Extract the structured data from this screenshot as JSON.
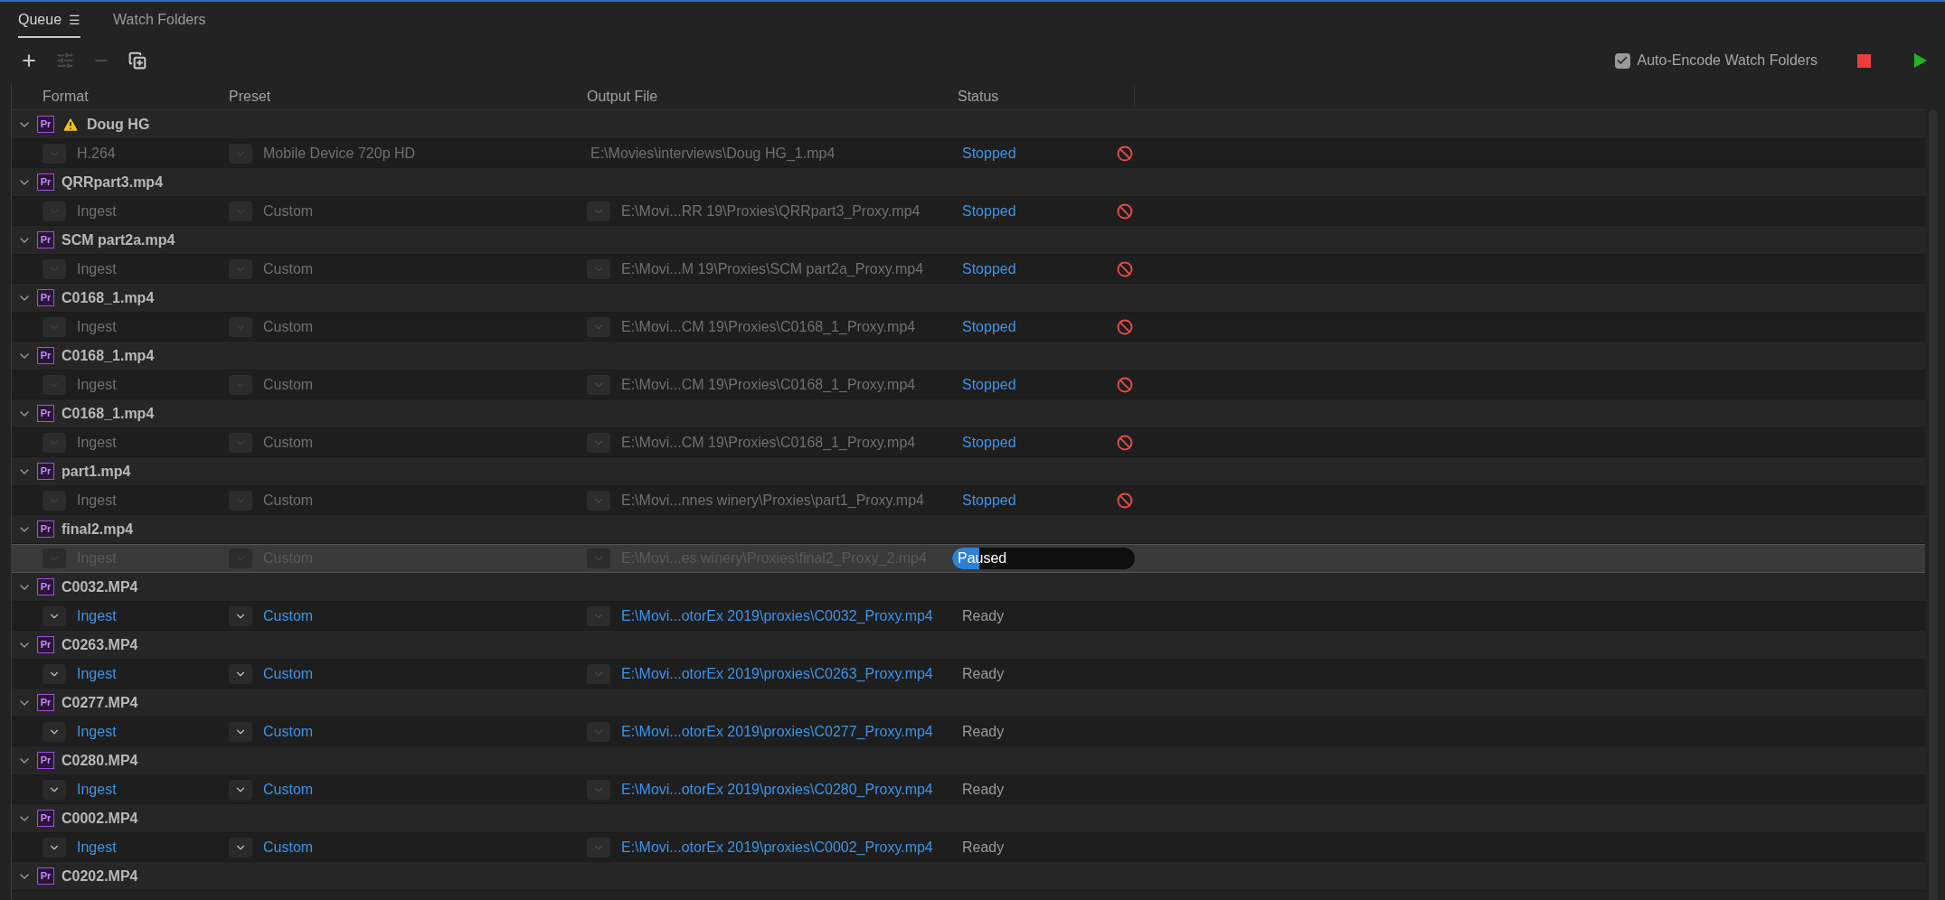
{
  "tabs": [
    {
      "label": "Queue",
      "selected": true,
      "menu": "☰"
    },
    {
      "label": "Watch Folders",
      "selected": false
    }
  ],
  "toolbar": [
    {
      "kind": "add",
      "disabled": false
    },
    {
      "kind": "settings",
      "disabled": true
    },
    {
      "kind": "remove",
      "disabled": true
    },
    {
      "kind": "duplicate",
      "disabled": false
    }
  ],
  "auto_encode": {
    "label": "Auto-Encode Watch Folders",
    "checked": true
  },
  "columns": [
    "Format",
    "Preset",
    "Output File",
    "Status"
  ],
  "groups": [
    {
      "name": "Doug HG",
      "badge": "Pr",
      "warning": true,
      "expanded": true,
      "items": [
        {
          "format": "H.264",
          "preset": "Mobile Device 720p HD",
          "output": "E:\\Movies\\interviews\\Doug HG_1.mp4",
          "output_menu": false,
          "enabled": false,
          "selected": false,
          "status": {
            "kind": "stopped",
            "text": "Stopped"
          }
        }
      ]
    },
    {
      "name": "QRRpart3.mp4",
      "badge": "Pr",
      "warning": false,
      "expanded": true,
      "items": [
        {
          "format": "Ingest",
          "preset": "Custom",
          "output": "E:\\Movi...RR 19\\Proxies\\QRRpart3_Proxy.mp4",
          "output_menu": true,
          "enabled": false,
          "selected": false,
          "status": {
            "kind": "stopped",
            "text": "Stopped"
          }
        }
      ]
    },
    {
      "name": "SCM part2a.mp4",
      "badge": "Pr",
      "warning": false,
      "expanded": true,
      "items": [
        {
          "format": "Ingest",
          "preset": "Custom",
          "output": "E:\\Movi...M 19\\Proxies\\SCM part2a_Proxy.mp4",
          "output_menu": true,
          "enabled": false,
          "selected": false,
          "status": {
            "kind": "stopped",
            "text": "Stopped"
          }
        }
      ]
    },
    {
      "name": "C0168_1.mp4",
      "badge": "Pr",
      "warning": false,
      "expanded": true,
      "items": [
        {
          "format": "Ingest",
          "preset": "Custom",
          "output": "E:\\Movi...CM 19\\Proxies\\C0168_1_Proxy.mp4",
          "output_menu": true,
          "enabled": false,
          "selected": false,
          "status": {
            "kind": "stopped",
            "text": "Stopped"
          }
        }
      ]
    },
    {
      "name": "C0168_1.mp4",
      "badge": "Pr",
      "warning": false,
      "expanded": true,
      "items": [
        {
          "format": "Ingest",
          "preset": "Custom",
          "output": "E:\\Movi...CM 19\\Proxies\\C0168_1_Proxy.mp4",
          "output_menu": true,
          "enabled": false,
          "selected": false,
          "status": {
            "kind": "stopped",
            "text": "Stopped"
          }
        }
      ]
    },
    {
      "name": "C0168_1.mp4",
      "badge": "Pr",
      "warning": false,
      "expanded": true,
      "items": [
        {
          "format": "Ingest",
          "preset": "Custom",
          "output": "E:\\Movi...CM 19\\Proxies\\C0168_1_Proxy.mp4",
          "output_menu": true,
          "enabled": false,
          "selected": false,
          "status": {
            "kind": "stopped",
            "text": "Stopped"
          }
        }
      ]
    },
    {
      "name": "part1.mp4",
      "badge": "Pr",
      "warning": false,
      "expanded": true,
      "items": [
        {
          "format": "Ingest",
          "preset": "Custom",
          "output": "E:\\Movi...nnes winery\\Proxies\\part1_Proxy.mp4",
          "output_menu": true,
          "enabled": false,
          "selected": false,
          "status": {
            "kind": "stopped",
            "text": "Stopped"
          }
        }
      ]
    },
    {
      "name": "final2.mp4",
      "badge": "Pr",
      "warning": false,
      "expanded": true,
      "items": [
        {
          "format": "Ingest",
          "preset": "Custom",
          "output": "E:\\Movi...es winery\\Proxies\\final2_Proxy_2.mp4",
          "output_menu": true,
          "enabled": false,
          "selected": true,
          "status": {
            "kind": "paused",
            "text": "Paused",
            "level": 0.15
          }
        }
      ]
    },
    {
      "name": "C0032.MP4",
      "badge": "Pr",
      "warning": false,
      "expanded": true,
      "items": [
        {
          "format": "Ingest",
          "preset": "Custom",
          "output": "E:\\Movi...otorEx 2019\\proxies\\C0032_Proxy.mp4",
          "output_menu": true,
          "enabled": true,
          "selected": false,
          "status": {
            "kind": "ready",
            "text": "Ready"
          }
        }
      ]
    },
    {
      "name": "C0263.MP4",
      "badge": "Pr",
      "warning": false,
      "expanded": true,
      "items": [
        {
          "format": "Ingest",
          "preset": "Custom",
          "output": "E:\\Movi...otorEx 2019\\proxies\\C0263_Proxy.mp4",
          "output_menu": true,
          "enabled": true,
          "selected": false,
          "status": {
            "kind": "ready",
            "text": "Ready"
          }
        }
      ]
    },
    {
      "name": "C0277.MP4",
      "badge": "Pr",
      "warning": false,
      "expanded": true,
      "items": [
        {
          "format": "Ingest",
          "preset": "Custom",
          "output": "E:\\Movi...otorEx 2019\\proxies\\C0277_Proxy.mp4",
          "output_menu": true,
          "enabled": true,
          "selected": false,
          "status": {
            "kind": "ready",
            "text": "Ready"
          }
        }
      ]
    },
    {
      "name": "C0280.MP4",
      "badge": "Pr",
      "warning": false,
      "expanded": true,
      "items": [
        {
          "format": "Ingest",
          "preset": "Custom",
          "output": "E:\\Movi...otorEx 2019\\proxies\\C0280_Proxy.mp4",
          "output_menu": true,
          "enabled": true,
          "selected": false,
          "status": {
            "kind": "ready",
            "text": "Ready"
          }
        }
      ]
    },
    {
      "name": "C0002.MP4",
      "badge": "Pr",
      "warning": false,
      "expanded": true,
      "items": [
        {
          "format": "Ingest",
          "preset": "Custom",
          "output": "E:\\Movi...otorEx 2019\\proxies\\C0002_Proxy.mp4",
          "output_menu": true,
          "enabled": true,
          "selected": false,
          "status": {
            "kind": "ready",
            "text": "Ready"
          }
        }
      ]
    },
    {
      "name": "C0202.MP4",
      "badge": "Pr",
      "warning": false,
      "expanded": true
    }
  ]
}
